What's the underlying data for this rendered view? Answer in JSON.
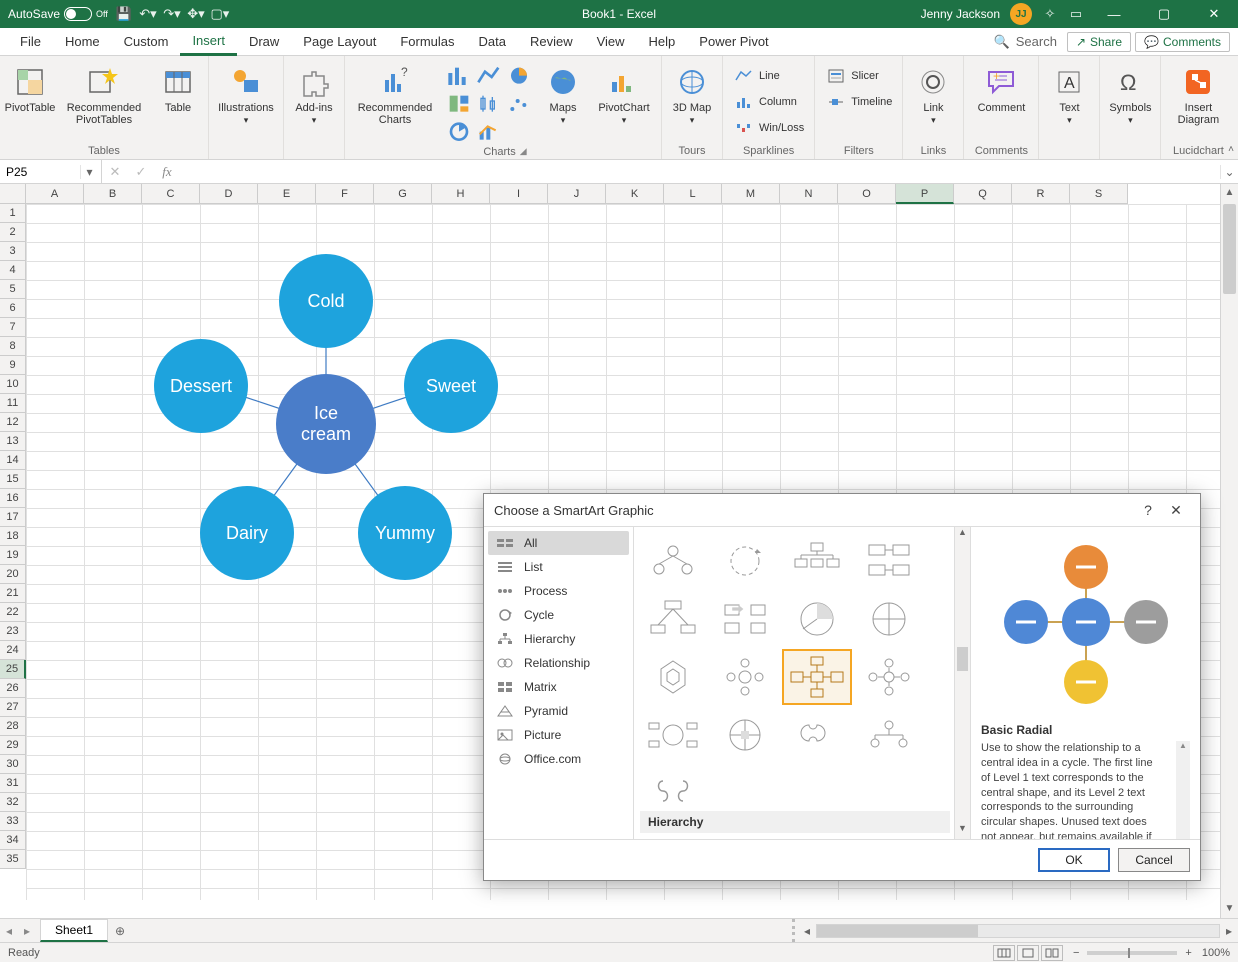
{
  "titlebar": {
    "autosave_label": "AutoSave",
    "autosave_state": "Off",
    "doc_title": "Book1 - Excel",
    "user_name": "Jenny Jackson",
    "user_initials": "JJ"
  },
  "tabs": {
    "items": [
      "File",
      "Home",
      "Custom",
      "Insert",
      "Draw",
      "Page Layout",
      "Formulas",
      "Data",
      "Review",
      "View",
      "Help",
      "Power Pivot"
    ],
    "active": "Insert",
    "search_placeholder": "Search",
    "share": "Share",
    "comments": "Comments"
  },
  "ribbon": {
    "groups": {
      "tables": {
        "label": "Tables",
        "pivottable": "PivotTable",
        "recommended_pivot": "Recommended PivotTables",
        "table": "Table"
      },
      "illustrations": {
        "label": "Illustrations",
        "btn": "Illustrations"
      },
      "addins": {
        "label": "Add-ins",
        "btn": "Add-ins"
      },
      "charts": {
        "label": "Charts",
        "recommended": "Recommended Charts",
        "maps": "Maps",
        "pivotchart": "PivotChart"
      },
      "tours": {
        "label": "Tours",
        "map": "3D Map"
      },
      "sparklines": {
        "label": "Sparklines",
        "line": "Line",
        "column": "Column",
        "winloss": "Win/Loss"
      },
      "filters": {
        "label": "Filters",
        "slicer": "Slicer",
        "timeline": "Timeline"
      },
      "links": {
        "label": "Links",
        "link": "Link"
      },
      "comments": {
        "label": "Comments",
        "comment": "Comment"
      },
      "text": {
        "label": "Text",
        "btn": "Text"
      },
      "symbols": {
        "label": "Symbols",
        "btn": "Symbols"
      },
      "lucid": {
        "label": "Lucidchart",
        "btn": "Insert Diagram"
      }
    }
  },
  "namebox": {
    "ref": "P25"
  },
  "grid": {
    "cols": [
      "A",
      "B",
      "C",
      "D",
      "E",
      "F",
      "G",
      "H",
      "I",
      "J",
      "K",
      "L",
      "M",
      "N",
      "O",
      "P",
      "Q",
      "R",
      "S"
    ],
    "rowcount": 35,
    "active_col": "P",
    "active_row": 25,
    "sheet_name": "Sheet1"
  },
  "smartart": {
    "center": "Ice cream",
    "outer": [
      "Cold",
      "Sweet",
      "Yummy",
      "Dairy",
      "Dessert"
    ]
  },
  "dialog": {
    "title": "Choose a SmartArt Graphic",
    "categories": [
      "All",
      "List",
      "Process",
      "Cycle",
      "Hierarchy",
      "Relationship",
      "Matrix",
      "Pyramid",
      "Picture",
      "Office.com"
    ],
    "selected_category": "All",
    "section_label": "Hierarchy",
    "preview_name": "Basic Radial",
    "preview_desc": "Use to show the relationship to a central idea in a cycle. The first line of Level 1 text corresponds to the central shape, and its Level 2 text corresponds to the surrounding circular shapes. Unused text does not appear, but remains available if you switch",
    "ok": "OK",
    "cancel": "Cancel"
  },
  "status": {
    "ready": "Ready",
    "zoom": "100%"
  }
}
